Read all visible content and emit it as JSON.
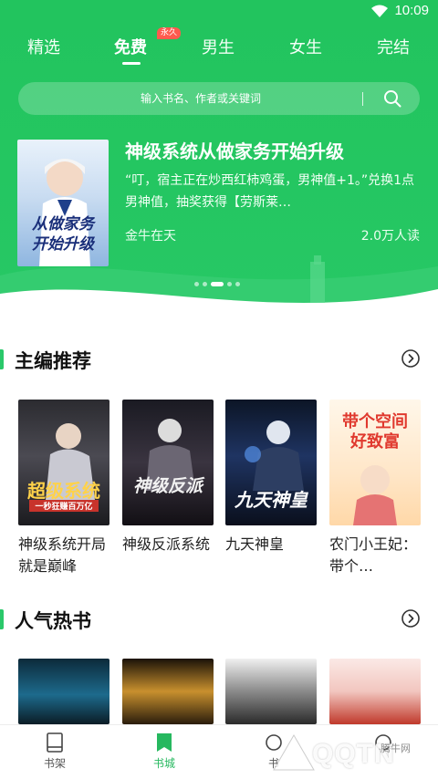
{
  "status_bar": {
    "time": "10:09"
  },
  "top_tabs": [
    {
      "label": "精选"
    },
    {
      "label": "免费",
      "badge": "永久"
    },
    {
      "label": "男生"
    },
    {
      "label": "女生"
    },
    {
      "label": "完结"
    }
  ],
  "search": {
    "placeholder": "输入书名、作者或关键词"
  },
  "featured": {
    "title": "神级系统从做家务开始升级",
    "description": "“叮，宿主正在炒西红柿鸡蛋，男神值+1。”兑换1点男神值，抽奖获得【劳斯莱…",
    "author": "金牛在天",
    "reads": "2.0万人读",
    "cover_text_1": "从做家务",
    "cover_text_2": "开始升级"
  },
  "carousel": {
    "count": 5,
    "active_index": 2
  },
  "editor_picks": {
    "title": "主编推荐",
    "books": [
      {
        "title": "神级系统开局就是巅峰",
        "cover_text": "超级系统",
        "cover_sub": "一秒狂赚百万亿"
      },
      {
        "title": "神级反派系统",
        "cover_text": "神级反派",
        "cover_sub": ""
      },
      {
        "title": "九天神皇",
        "cover_text": "九天神皇",
        "cover_sub": ""
      },
      {
        "title": "农门小王妃：带个…",
        "cover_text": "带个空间好致富",
        "cover_sub": ""
      }
    ]
  },
  "popular": {
    "title": "人气热书"
  },
  "bottom_nav": [
    {
      "label": "书架"
    },
    {
      "label": "书城"
    },
    {
      "label": "书"
    },
    {
      "label": ""
    }
  ],
  "watermark": {
    "text": "QQTN",
    "small": "腾牛网"
  },
  "colors": {
    "primary_green": "#22c45e",
    "accent": "#26b85f",
    "badge": "#ff5a4e"
  }
}
